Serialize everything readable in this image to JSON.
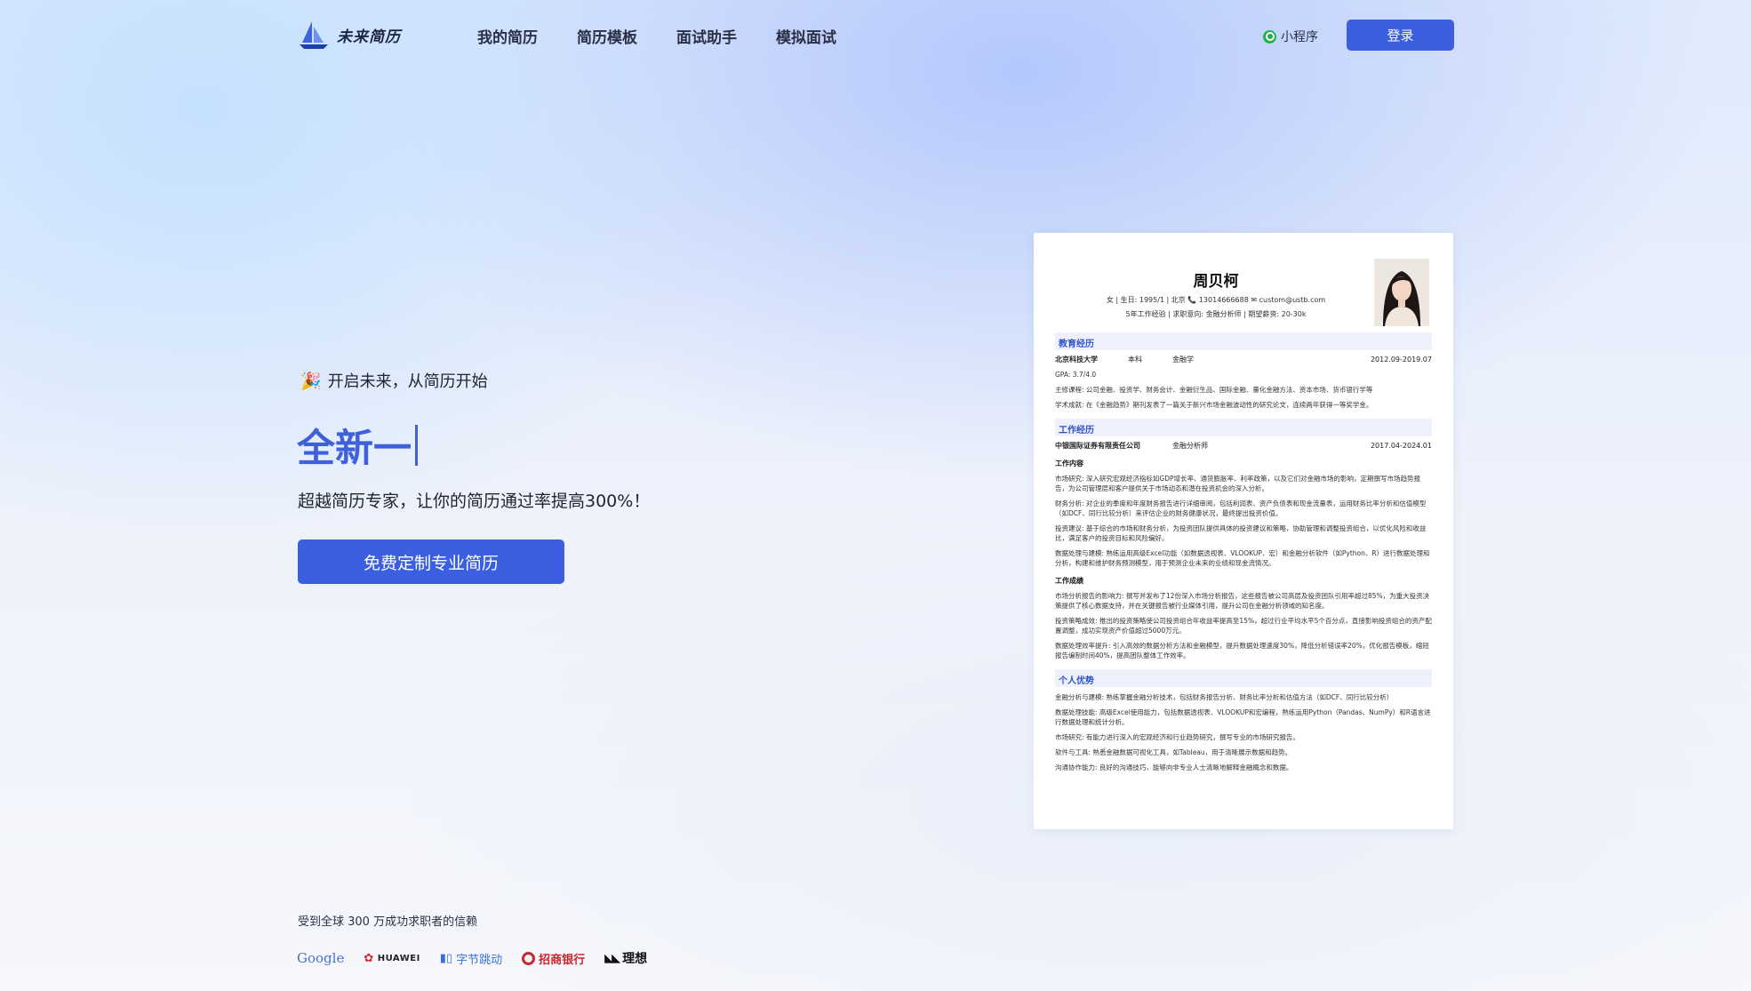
{
  "header": {
    "logo_text": "未来简历",
    "nav": [
      "我的简历",
      "简历模板",
      "面试助手",
      "模拟面试"
    ],
    "mini_program": "小程序",
    "login": "登录"
  },
  "hero": {
    "tagline": "开启未来，从简历开始",
    "headline": "全新一",
    "subtitle": "超越简历专家，让你的简历通过率提高300%！",
    "cta": "免费定制专业简历",
    "trust_text": "受到全球 300 万成功求职者的信赖"
  },
  "brands": {
    "google": "Google",
    "huawei": "HUAWEI",
    "bytedance": "字节跳动",
    "cmb": "招商银行",
    "lixiang": "理想"
  },
  "resume": {
    "name": "周贝柯",
    "info_line1": "女 | 生日: 1995/1 | 北京 📞 13014666688 ✉ custom@ustb.com",
    "info_line2": "5年工作经验 | 求职意向: 金融分析师 | 期望薪资: 20-30k",
    "education": {
      "title": "教育经历",
      "school": "北京科技大学",
      "degree": "本科",
      "major": "金融学",
      "date": "2012.09-2019.07",
      "gpa": "GPA: 3.7/4.0",
      "courses": "主修课程: 公司金融、投资学、财务会计、金融衍生品、国际金融、量化金融方法、资本市场、货币银行学等",
      "achievement": "学术成就: 在《金融趋势》期刊发表了一篇关于新兴市场金融波动性的研究论文，连续两年获得一等奖学金。"
    },
    "work": {
      "title": "工作经历",
      "company": "中银国际证券有限责任公司",
      "role": "金融分析师",
      "date": "2017.04-2024.01",
      "content_title": "工作内容",
      "items": [
        "市场研究: 深入研究宏观经济指标如GDP增长率、通货膨胀率、利率政策，以及它们对金融市场的影响，定期撰写市场趋势报告，为公司管理层和客户提供关于市场动态和潜在投资机会的深入分析。",
        "财务分析: 对企业的季度和年度财务报告进行详细审阅，包括利润表、资产负债表和现金流量表，运用财务比率分析和估值模型（如DCF、同行比较分析）来评估企业的财务健康状况，最终提出投资价值。",
        "投资建议: 基于综合的市场和财务分析，为投资团队提供具体的投资建议和策略，协助管理和调整投资组合，以优化风险和收益比，满足客户的投资目标和风险偏好。",
        "数据处理与建模: 熟练运用高级Excel功能（如数据透视表、VLOOKUP、宏）和金融分析软件（如Python、R）进行数据处理和分析，构建和维护财务预测模型，用于预测企业未来的业绩和现金流情况。"
      ],
      "results_title": "工作成绩",
      "results": [
        "市场分析报告的影响力: 撰写并发布了12份深入市场分析报告，这些报告被公司高层及投资团队引用率超过85%，为重大投资决策提供了核心数据支持，并在关键报告被行业媒体引用，提升公司在金融分析领域的知名度。",
        "投资策略成效: 推出的投资策略使公司投资组合年收益率提高至15%，超过行业平均水平5个百分点，直接影响投资组合的资产配置调整，成功实现资产价值超过5000万元。",
        "数据处理效率提升: 引入高效的数据分析方法和金融模型，提升数据处理速度30%，降低分析错误率20%，优化报告模板，缩短报告编制时间40%，提高团队整体工作效率。"
      ]
    },
    "skills": {
      "title": "个人优势",
      "items": [
        "金融分析与建模: 熟练掌握金融分析技术，包括财务报告分析、财务比率分析和估值方法（如DCF、同行比较分析）",
        "数据处理技能: 高级Excel使用能力，包括数据透视表、VLOOKUP和宏编程，熟练运用Python（Pandas、NumPy）和R语言进行数据处理和统计分析。",
        "市场研究: 有能力进行深入的宏观经济和行业趋势研究，撰写专业的市场研究报告。",
        "软件与工具: 熟悉金融数据可视化工具，如Tableau，用于清晰展示数据和趋势。",
        "沟通协作能力: 良好的沟通技巧，能够向非专业人士清晰地解释金融概念和数据。"
      ]
    }
  },
  "colors": {
    "primary": "#3b5fe0",
    "headline": "#3f60db",
    "section_bg": "#eef1fb"
  }
}
